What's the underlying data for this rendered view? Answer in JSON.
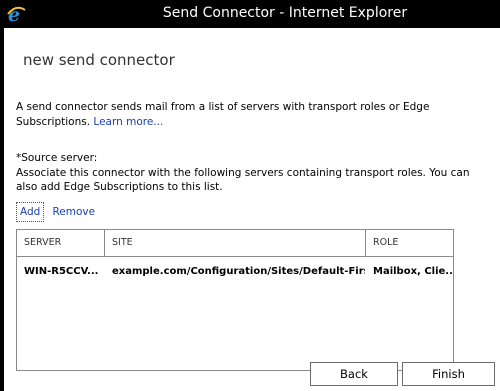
{
  "window": {
    "title": "Send Connector - Internet Explorer",
    "icon": "ie-icon"
  },
  "dialog": {
    "title": "new send connector",
    "description": "A send connector sends mail from a list of servers with transport roles or Edge Subscriptions.",
    "learn_more": "Learn more...",
    "source_label": "*Source server:",
    "source_description": "Associate this connector with the following servers containing transport roles. You can also add Edge Subscriptions to this list.",
    "actions": {
      "add": "Add",
      "remove": "Remove"
    }
  },
  "table": {
    "columns": [
      "SERVER",
      "SITE",
      "ROLE"
    ],
    "rows": [
      {
        "server": "WIN-R5CCV...",
        "site": "example.com/Configuration/Sites/Default-First-...",
        "role": "Mailbox, Clie..."
      }
    ]
  },
  "buttons": {
    "back": "Back",
    "finish": "Finish"
  }
}
